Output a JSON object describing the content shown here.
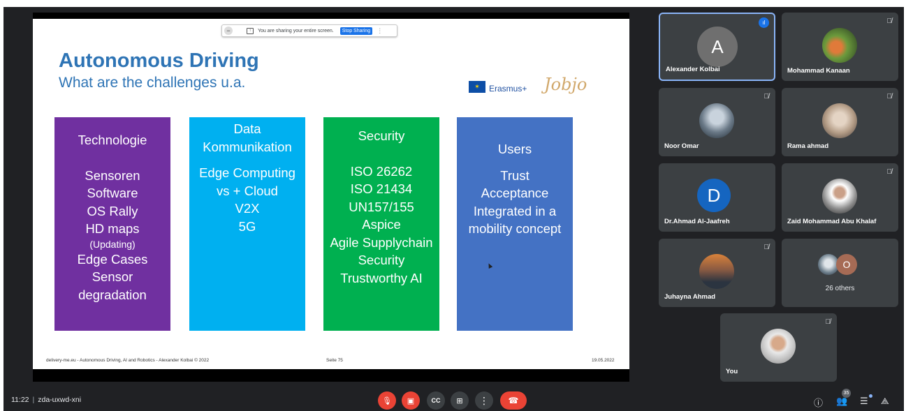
{
  "share_banner": {
    "text": "You are sharing your entire screen.",
    "stop_label": "Stop Sharing"
  },
  "slide": {
    "title": "Autonomous Driving",
    "subtitle": "What are the challenges u.a.",
    "logos": {
      "erasmus": "Erasmus+",
      "jobjo": "Jobjo"
    },
    "boxes": {
      "technologie": {
        "title": "Technologie",
        "items": [
          "Sensoren",
          "Software",
          "OS Rally",
          "HD maps",
          "(Updating)",
          "Edge Cases",
          "Sensor",
          "degradation"
        ],
        "color": "#7030a0"
      },
      "data": {
        "title_lines": [
          "Data",
          "Kommunikation"
        ],
        "items": [
          "Edge Computing",
          "vs + Cloud",
          "V2X",
          "5G"
        ],
        "color": "#00b0f0"
      },
      "security": {
        "title": "Security",
        "items": [
          "ISO 26262",
          "ISO 21434",
          "UN157/155",
          "Aspice",
          "Agile Supplychain",
          "Security",
          "Trustworthy AI"
        ],
        "color": "#00b050"
      },
      "users": {
        "title": "Users",
        "items": [
          "Trust",
          "Acceptance",
          "Integrated in a",
          "mobility concept"
        ],
        "color": "#4472c4"
      }
    },
    "footer": {
      "left": "delivery-me.eu - Autonomous Driving, AI and Robotics - Alexander Kolbai © 2022",
      "center": "Seite 75",
      "right": "19.05.2022"
    }
  },
  "participants": [
    {
      "name": "Alexander Kolbai",
      "initial": "A",
      "avatar_color": "#6f6f6f",
      "speaking": true
    },
    {
      "name": "Mohammad Kanaan",
      "muted": true,
      "avatar": "photo"
    },
    {
      "name": "Noor Omar",
      "muted": true,
      "avatar": "photo"
    },
    {
      "name": "Rama ahmad",
      "muted": true,
      "avatar": "photo"
    },
    {
      "name": "Dr.Ahmad Al-Jaafreh",
      "initial": "D",
      "avatar_color": "#1565c0"
    },
    {
      "name": "Zaid Mohammad Abu Khalaf",
      "muted": true,
      "avatar": "photo"
    },
    {
      "name": "Juhayna Ahmad",
      "muted": true,
      "avatar": "photo"
    },
    {
      "name": "You",
      "muted": true,
      "avatar": "photo"
    }
  ],
  "others": {
    "initial": "O",
    "label": "26 others"
  },
  "bottom_bar": {
    "time": "11:22",
    "meeting_code": "zda-uxwd-xni",
    "people_count": "35"
  },
  "icons": {
    "mic_muted": "mic-off-icon",
    "camera_off": "videocam-off-icon",
    "captions": "closed-caption-icon",
    "present": "present-icon",
    "more": "more-vert-icon",
    "end_call": "call-end-icon",
    "info": "info-icon",
    "people": "people-icon",
    "chat": "chat-icon",
    "activities": "activities-icon"
  },
  "colors": {
    "meet_bg": "#202124",
    "tile_bg": "#3c4043",
    "danger": "#ea4335",
    "accent": "#8ab4f8",
    "title_blue": "#2e74b5"
  }
}
